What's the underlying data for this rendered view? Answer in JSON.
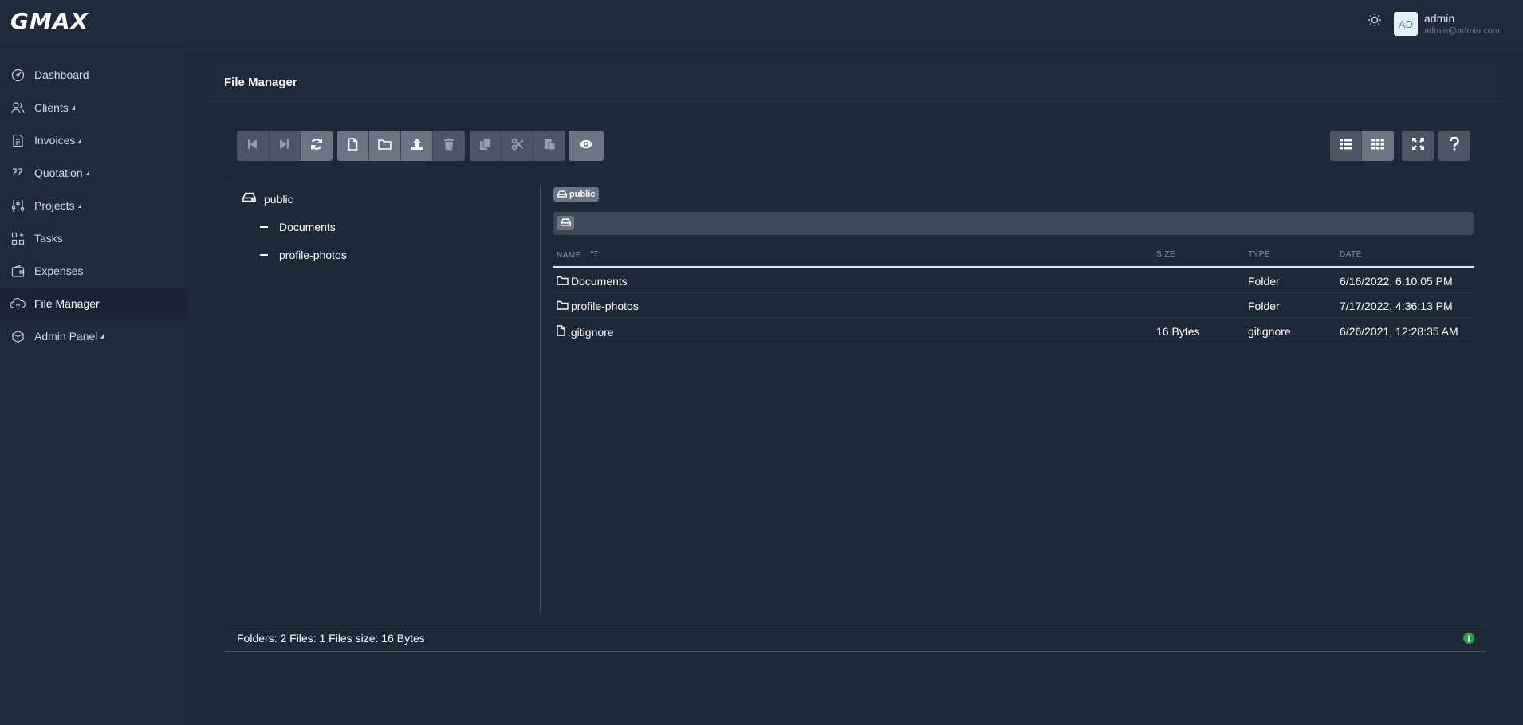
{
  "brand": {
    "logo": "GMAX"
  },
  "header": {
    "theme_icon": "sun-icon",
    "user": {
      "initials": "AD",
      "name": "admin",
      "email": "admin@admin.com"
    }
  },
  "sidebar": {
    "items": [
      {
        "label": "Dashboard",
        "icon": "gauge-icon",
        "submenu": false
      },
      {
        "label": "Clients",
        "icon": "users-icon",
        "submenu": true
      },
      {
        "label": "Invoices",
        "icon": "invoice-icon",
        "submenu": true
      },
      {
        "label": "Quotation",
        "icon": "quote-icon",
        "submenu": true
      },
      {
        "label": "Projects",
        "icon": "sliders-icon",
        "submenu": true
      },
      {
        "label": "Tasks",
        "icon": "apps-icon",
        "submenu": false
      },
      {
        "label": "Expenses",
        "icon": "wallet-icon",
        "submenu": false
      },
      {
        "label": "File Manager",
        "icon": "cloud-upload-icon",
        "submenu": false,
        "active": true
      },
      {
        "label": "Admin Panel",
        "icon": "cube-icon",
        "submenu": true
      }
    ]
  },
  "card": {
    "title": "File Manager"
  },
  "toolbar": {
    "nav_buttons": [
      "step-back-icon",
      "step-forward-icon",
      "refresh-icon"
    ],
    "file_buttons": [
      "new-file-icon",
      "new-folder-icon",
      "upload-icon",
      "trash-icon"
    ],
    "clip_buttons": [
      "copy-icon",
      "cut-icon",
      "paste-icon"
    ],
    "preview_button": "eye-icon",
    "view_buttons": [
      "list-view-icon",
      "grid-view-icon"
    ],
    "fullscreen_button": "expand-icon",
    "help_button": "question-icon"
  },
  "tree": {
    "root": "public",
    "children": [
      "Documents",
      "profile-photos"
    ]
  },
  "breadcrumb": {
    "disk": "public"
  },
  "table": {
    "headers": {
      "name": "NAME",
      "size": "SIZE",
      "type": "TYPE",
      "date": "DATE"
    },
    "rows": [
      {
        "name": "Documents",
        "size": "",
        "type": "Folder",
        "date": "6/16/2022, 6:10:05 PM",
        "icon": "folder-icon"
      },
      {
        "name": "profile-photos",
        "size": "",
        "type": "Folder",
        "date": "7/17/2022, 4:36:13 PM",
        "icon": "folder-icon"
      },
      {
        "name": ".gitignore",
        "size": "16 Bytes",
        "type": "gitignore",
        "date": "6/26/2021, 12:28:35 AM",
        "icon": "file-icon"
      }
    ]
  },
  "footer": {
    "status": "Folders: 2 Files: 1 Files size: 16 Bytes",
    "info_icon": "info-icon",
    "status_color": "#22a447"
  },
  "colors": {
    "background": "#1e293b",
    "sidebar": "#1f2a3c",
    "button": "#4b5565",
    "button_active": "#6b7482"
  }
}
